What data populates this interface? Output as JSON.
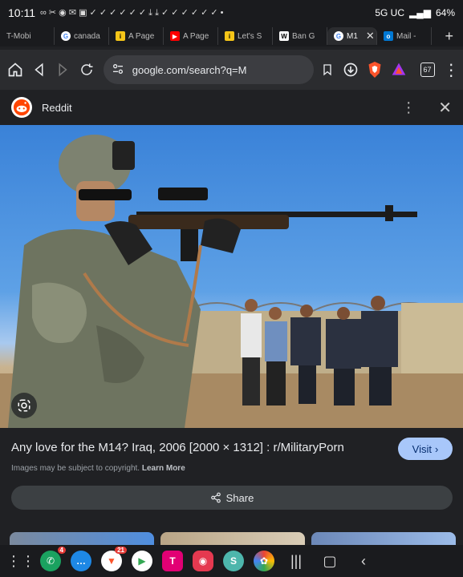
{
  "status": {
    "time": "10:11",
    "network": "5G UC",
    "battery": "64%"
  },
  "tabs": [
    {
      "label": "T-Mobi",
      "favicon": "t-mobile-icon",
      "color": "#5f6368"
    },
    {
      "label": "canada",
      "favicon": "google-icon",
      "color": "#ffffff"
    },
    {
      "label": "A Page",
      "favicon": "imdb-icon",
      "color": "#f5c518"
    },
    {
      "label": "A Page",
      "favicon": "youtube-icon",
      "color": "#ff0000"
    },
    {
      "label": "Let's S",
      "favicon": "imdb-icon",
      "color": "#f5c518"
    },
    {
      "label": "Ban G",
      "favicon": "wikipedia-icon",
      "color": "#ffffff"
    },
    {
      "label": "M1",
      "favicon": "google-icon",
      "color": "#ffffff",
      "active": true
    },
    {
      "label": "Mail -",
      "favicon": "outlook-icon",
      "color": "#0078d4"
    }
  ],
  "toolbar": {
    "url": "google.com/search?q=M",
    "tab_count": "67"
  },
  "source": {
    "name": "Reddit"
  },
  "result": {
    "title": "Any love for the M14? Iraq, 2006 [2000 × 1312] : r/MilitaryPorn",
    "visit_label": "Visit",
    "copyright_text": "Images may be subject to copyright.",
    "learn_more": "Learn More",
    "share_label": "Share"
  },
  "dock": {
    "phone_badge": "4",
    "brave_badge": "21"
  },
  "colors": {
    "accent": "#a8c7fa",
    "reddit": "#ff4500",
    "tmobile": "#e20074"
  }
}
